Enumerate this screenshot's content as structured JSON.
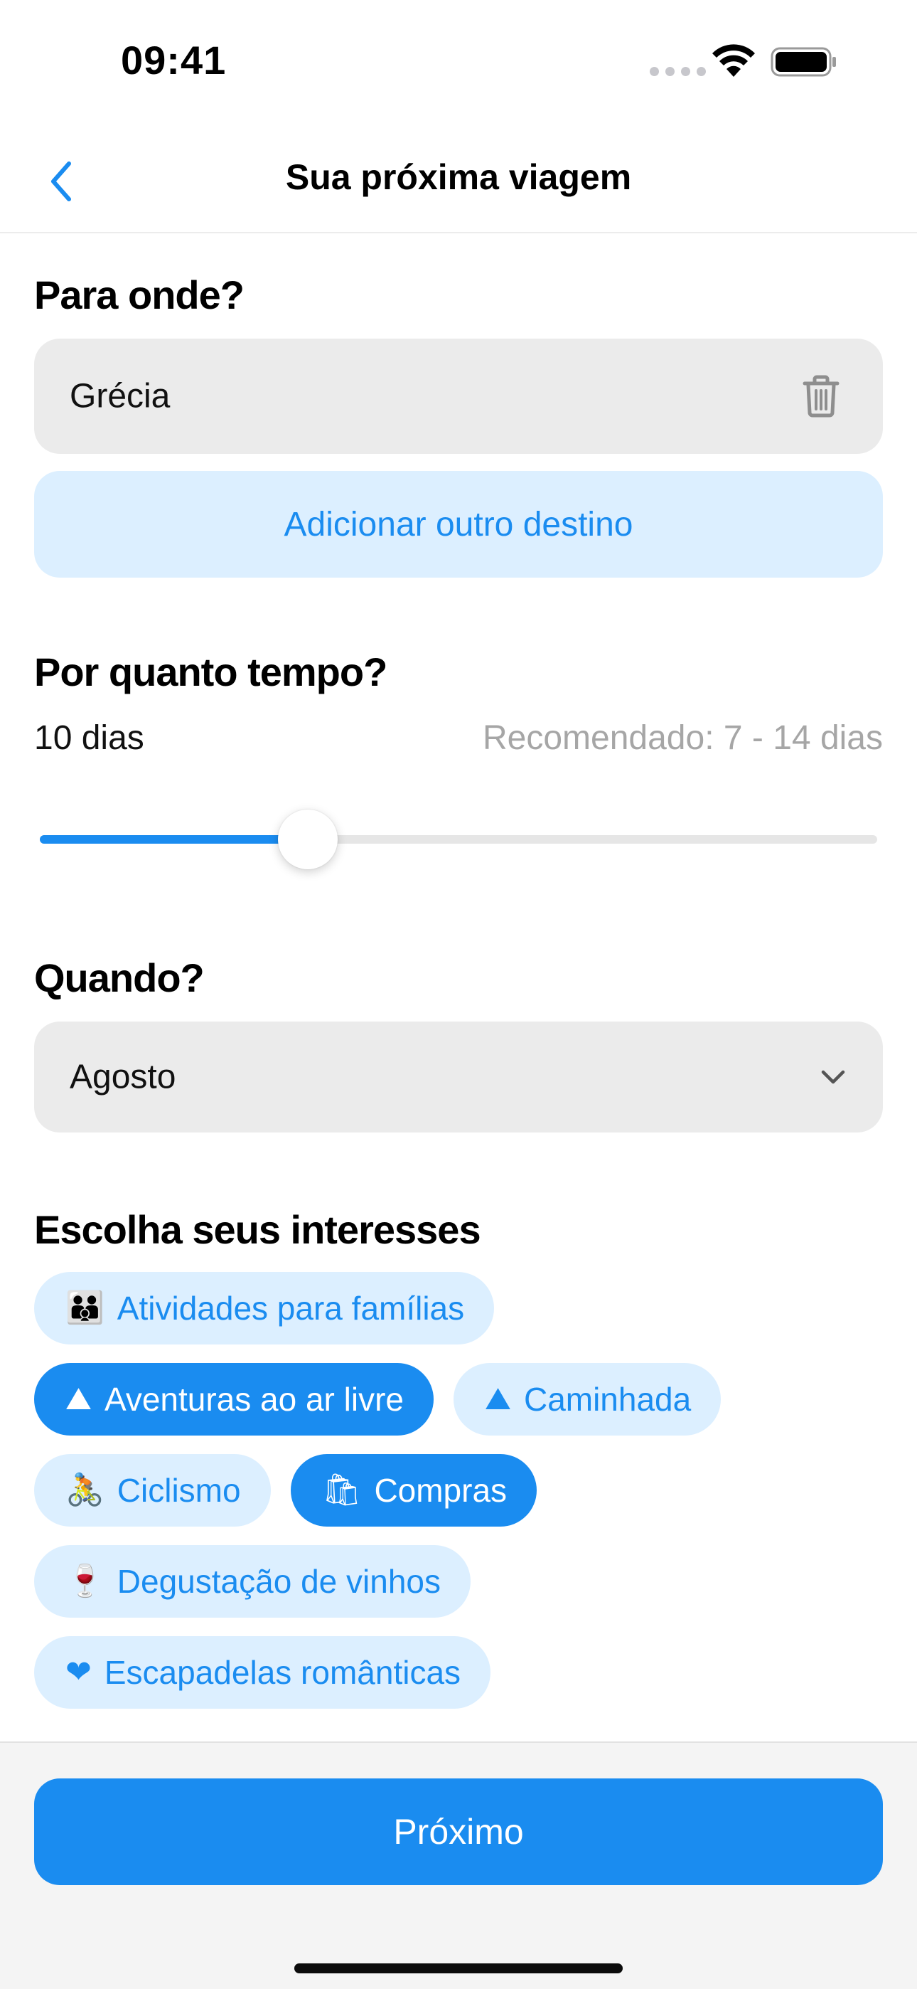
{
  "status_bar": {
    "time": "09:41"
  },
  "nav": {
    "title": "Sua próxima viagem"
  },
  "destination": {
    "title": "Para onde?",
    "value": "Grécia",
    "add_label": "Adicionar outro destino"
  },
  "duration": {
    "title": "Por quanto tempo?",
    "value_label": "10 dias",
    "recommended_label": "Recomendado: 7 - 14 dias",
    "slider_fraction": 0.32
  },
  "when": {
    "title": "Quando?",
    "value": "Agosto"
  },
  "interests": {
    "title": "Escolha seus interesses",
    "rows": [
      [
        {
          "icon": "👪",
          "label": "Atividades para famílias",
          "selected": false
        }
      ],
      [
        {
          "icon": "⛰",
          "label": "Aventuras ao ar livre",
          "selected": true
        },
        {
          "icon": "⛰",
          "label": "Caminhada",
          "selected": false
        }
      ],
      [
        {
          "icon": "🚴",
          "label": "Ciclismo",
          "selected": false
        },
        {
          "icon": "🛍",
          "label": "Compras",
          "selected": true
        }
      ],
      [
        {
          "icon": "🍷",
          "label": "Degustação de vinhos",
          "selected": false
        }
      ],
      [
        {
          "icon": "❤",
          "label": "Escapadelas românticas",
          "selected": false
        }
      ]
    ]
  },
  "footer": {
    "next_label": "Próximo"
  },
  "colors": {
    "accent": "#1a8cf0",
    "chip_bg": "#dcefff",
    "field_bg": "#ebebeb"
  }
}
